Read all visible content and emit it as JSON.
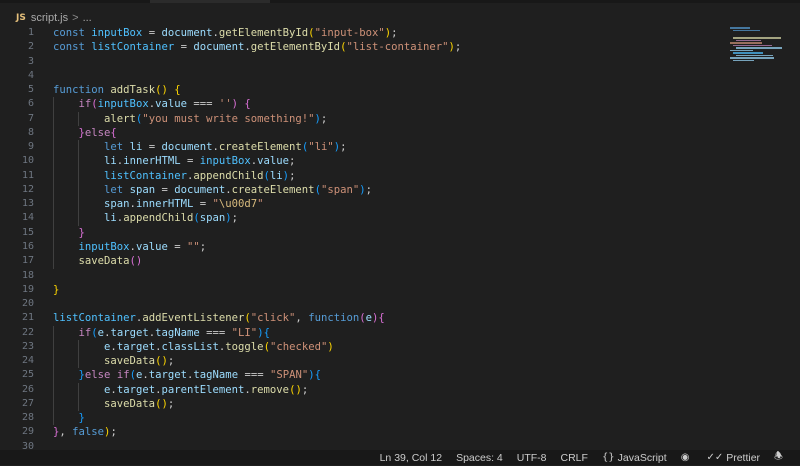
{
  "breadcrumb": {
    "file_icon": "JS",
    "file": "script.js",
    "separator": ">",
    "trail": "..."
  },
  "colors": {
    "keyword": "#569cd6",
    "control": "#c586c0",
    "variable": "#9cdcfe",
    "function": "#dcdcaa",
    "string": "#ce9178",
    "text": "#cccccc",
    "bracket1": "#ffd700",
    "bracket2": "#da70d6",
    "bracket3": "#179fff",
    "escape": "#d7ba7d",
    "line_number": "#6e7681"
  },
  "code_lines": [
    {
      "num": "1",
      "segments": [
        [
          "const",
          "keyword"
        ],
        [
          " ",
          "text"
        ],
        [
          "inputBox",
          "const"
        ],
        [
          " = ",
          "text"
        ],
        [
          "document",
          "variable"
        ],
        [
          ".",
          "text"
        ],
        [
          "getElementById",
          "function"
        ],
        [
          "(",
          "bracket1"
        ],
        [
          "\"input-box\"",
          "string"
        ],
        [
          ")",
          "bracket1"
        ],
        [
          ";",
          "text"
        ]
      ]
    },
    {
      "num": "2",
      "segments": [
        [
          "const",
          "keyword"
        ],
        [
          " ",
          "text"
        ],
        [
          "listContainer",
          "const"
        ],
        [
          " = ",
          "text"
        ],
        [
          "document",
          "variable"
        ],
        [
          ".",
          "text"
        ],
        [
          "getElementById",
          "function"
        ],
        [
          "(",
          "bracket1"
        ],
        [
          "\"list-container\"",
          "string"
        ],
        [
          ")",
          "bracket1"
        ],
        [
          ";",
          "text"
        ]
      ]
    },
    {
      "num": "3",
      "segments": []
    },
    {
      "num": "4",
      "segments": []
    },
    {
      "num": "5",
      "segments": [
        [
          "function",
          "keyword"
        ],
        [
          " ",
          "text"
        ],
        [
          "addTask",
          "function"
        ],
        [
          "()",
          "bracket1"
        ],
        [
          " ",
          "text"
        ],
        [
          "{",
          "bracket1"
        ]
      ]
    },
    {
      "num": "6",
      "segments": [
        [
          "    ",
          "text"
        ],
        [
          "if",
          "control"
        ],
        [
          "(",
          "bracket2"
        ],
        [
          "inputBox",
          "const"
        ],
        [
          ".",
          "text"
        ],
        [
          "value",
          "variable"
        ],
        [
          " === ",
          "text"
        ],
        [
          "''",
          "string"
        ],
        [
          ")",
          "bracket2"
        ],
        [
          " ",
          "text"
        ],
        [
          "{",
          "bracket2"
        ]
      ]
    },
    {
      "num": "7",
      "segments": [
        [
          "        ",
          "text"
        ],
        [
          "alert",
          "function"
        ],
        [
          "(",
          "bracket3"
        ],
        [
          "\"you must write something!\"",
          "string"
        ],
        [
          ")",
          "bracket3"
        ],
        [
          ";",
          "text"
        ]
      ]
    },
    {
      "num": "8",
      "segments": [
        [
          "    ",
          "text"
        ],
        [
          "}",
          "bracket2"
        ],
        [
          "else",
          "control"
        ],
        [
          "{",
          "bracket2"
        ]
      ]
    },
    {
      "num": "9",
      "segments": [
        [
          "        ",
          "text"
        ],
        [
          "let",
          "keyword"
        ],
        [
          " ",
          "text"
        ],
        [
          "li",
          "variable"
        ],
        [
          " = ",
          "text"
        ],
        [
          "document",
          "variable"
        ],
        [
          ".",
          "text"
        ],
        [
          "createElement",
          "function"
        ],
        [
          "(",
          "bracket3"
        ],
        [
          "\"li\"",
          "string"
        ],
        [
          ")",
          "bracket3"
        ],
        [
          ";",
          "text"
        ]
      ]
    },
    {
      "num": "10",
      "segments": [
        [
          "        ",
          "text"
        ],
        [
          "li",
          "variable"
        ],
        [
          ".",
          "text"
        ],
        [
          "innerHTML",
          "variable"
        ],
        [
          " = ",
          "text"
        ],
        [
          "inputBox",
          "const"
        ],
        [
          ".",
          "text"
        ],
        [
          "value",
          "variable"
        ],
        [
          ";",
          "text"
        ]
      ]
    },
    {
      "num": "11",
      "segments": [
        [
          "        ",
          "text"
        ],
        [
          "listContainer",
          "const"
        ],
        [
          ".",
          "text"
        ],
        [
          "appendChild",
          "function"
        ],
        [
          "(",
          "bracket3"
        ],
        [
          "li",
          "variable"
        ],
        [
          ")",
          "bracket3"
        ],
        [
          ";",
          "text"
        ]
      ]
    },
    {
      "num": "12",
      "segments": [
        [
          "        ",
          "text"
        ],
        [
          "let",
          "keyword"
        ],
        [
          " ",
          "text"
        ],
        [
          "span",
          "variable"
        ],
        [
          " = ",
          "text"
        ],
        [
          "document",
          "variable"
        ],
        [
          ".",
          "text"
        ],
        [
          "createElement",
          "function"
        ],
        [
          "(",
          "bracket3"
        ],
        [
          "\"span\"",
          "string"
        ],
        [
          ")",
          "bracket3"
        ],
        [
          ";",
          "text"
        ]
      ]
    },
    {
      "num": "13",
      "segments": [
        [
          "        ",
          "text"
        ],
        [
          "span",
          "variable"
        ],
        [
          ".",
          "text"
        ],
        [
          "innerHTML",
          "variable"
        ],
        [
          " = ",
          "text"
        ],
        [
          "\"",
          "string"
        ],
        [
          "\\u00d7",
          "escape"
        ],
        [
          "\"",
          "string"
        ]
      ]
    },
    {
      "num": "14",
      "segments": [
        [
          "        ",
          "text"
        ],
        [
          "li",
          "variable"
        ],
        [
          ".",
          "text"
        ],
        [
          "appendChild",
          "function"
        ],
        [
          "(",
          "bracket3"
        ],
        [
          "span",
          "variable"
        ],
        [
          ")",
          "bracket3"
        ],
        [
          ";",
          "text"
        ]
      ]
    },
    {
      "num": "15",
      "segments": [
        [
          "    ",
          "text"
        ],
        [
          "}",
          "bracket2"
        ]
      ]
    },
    {
      "num": "16",
      "segments": [
        [
          "    ",
          "text"
        ],
        [
          "inputBox",
          "const"
        ],
        [
          ".",
          "text"
        ],
        [
          "value",
          "variable"
        ],
        [
          " = ",
          "text"
        ],
        [
          "\"\"",
          "string"
        ],
        [
          ";",
          "text"
        ]
      ]
    },
    {
      "num": "17",
      "segments": [
        [
          "    ",
          "text"
        ],
        [
          "saveData",
          "function"
        ],
        [
          "()",
          "bracket2"
        ]
      ]
    },
    {
      "num": "18",
      "segments": []
    },
    {
      "num": "19",
      "segments": [
        [
          "}",
          "bracket1"
        ]
      ]
    },
    {
      "num": "20",
      "segments": []
    },
    {
      "num": "21",
      "segments": [
        [
          "listContainer",
          "const"
        ],
        [
          ".",
          "text"
        ],
        [
          "addEventListener",
          "function"
        ],
        [
          "(",
          "bracket1"
        ],
        [
          "\"click\"",
          "string"
        ],
        [
          ", ",
          "text"
        ],
        [
          "function",
          "keyword"
        ],
        [
          "(",
          "bracket2"
        ],
        [
          "e",
          "variable"
        ],
        [
          ")",
          "bracket2"
        ],
        [
          "{",
          "bracket2"
        ]
      ]
    },
    {
      "num": "22",
      "segments": [
        [
          "    ",
          "text"
        ],
        [
          "if",
          "control"
        ],
        [
          "(",
          "bracket3"
        ],
        [
          "e",
          "variable"
        ],
        [
          ".",
          "text"
        ],
        [
          "target",
          "variable"
        ],
        [
          ".",
          "text"
        ],
        [
          "tagName",
          "variable"
        ],
        [
          " === ",
          "text"
        ],
        [
          "\"LI\"",
          "string"
        ],
        [
          ")",
          "bracket3"
        ],
        [
          "{",
          "bracket3"
        ]
      ]
    },
    {
      "num": "23",
      "segments": [
        [
          "        ",
          "text"
        ],
        [
          "e",
          "variable"
        ],
        [
          ".",
          "text"
        ],
        [
          "target",
          "variable"
        ],
        [
          ".",
          "text"
        ],
        [
          "classList",
          "variable"
        ],
        [
          ".",
          "text"
        ],
        [
          "toggle",
          "function"
        ],
        [
          "(",
          "bracket1"
        ],
        [
          "\"checked\"",
          "string"
        ],
        [
          ")",
          "bracket1"
        ]
      ]
    },
    {
      "num": "24",
      "segments": [
        [
          "        ",
          "text"
        ],
        [
          "saveData",
          "function"
        ],
        [
          "()",
          "bracket1"
        ],
        [
          ";",
          "text"
        ]
      ]
    },
    {
      "num": "25",
      "segments": [
        [
          "    ",
          "text"
        ],
        [
          "}",
          "bracket3"
        ],
        [
          "else",
          "control"
        ],
        [
          " ",
          "text"
        ],
        [
          "if",
          "control"
        ],
        [
          "(",
          "bracket3"
        ],
        [
          "e",
          "variable"
        ],
        [
          ".",
          "text"
        ],
        [
          "target",
          "variable"
        ],
        [
          ".",
          "text"
        ],
        [
          "tagName",
          "variable"
        ],
        [
          " === ",
          "text"
        ],
        [
          "\"SPAN\"",
          "string"
        ],
        [
          ")",
          "bracket3"
        ],
        [
          "{",
          "bracket3"
        ]
      ]
    },
    {
      "num": "26",
      "segments": [
        [
          "        ",
          "text"
        ],
        [
          "e",
          "variable"
        ],
        [
          ".",
          "text"
        ],
        [
          "target",
          "variable"
        ],
        [
          ".",
          "text"
        ],
        [
          "parentElement",
          "variable"
        ],
        [
          ".",
          "text"
        ],
        [
          "remove",
          "function"
        ],
        [
          "()",
          "bracket1"
        ],
        [
          ";",
          "text"
        ]
      ]
    },
    {
      "num": "27",
      "segments": [
        [
          "        ",
          "text"
        ],
        [
          "saveData",
          "function"
        ],
        [
          "()",
          "bracket1"
        ],
        [
          ";",
          "text"
        ]
      ]
    },
    {
      "num": "28",
      "segments": [
        [
          "    ",
          "text"
        ],
        [
          "}",
          "bracket3"
        ]
      ]
    },
    {
      "num": "29",
      "segments": [
        [
          "}",
          "bracket2"
        ],
        [
          ", ",
          "text"
        ],
        [
          "false",
          "keyword"
        ],
        [
          ")",
          "bracket1"
        ],
        [
          ";",
          "text"
        ]
      ]
    },
    {
      "num": "30",
      "segments": []
    }
  ],
  "statusbar": {
    "position": "Ln 39, Col 12",
    "spaces": "Spaces: 4",
    "encoding": "UTF-8",
    "eol": "CRLF",
    "language_icon": "braces-icon",
    "language": "JavaScript",
    "copilot_icon": "copilot-icon",
    "prettier_icon": "double-check-icon",
    "prettier": "Prettier",
    "notifications_icon": "bell-icon"
  }
}
